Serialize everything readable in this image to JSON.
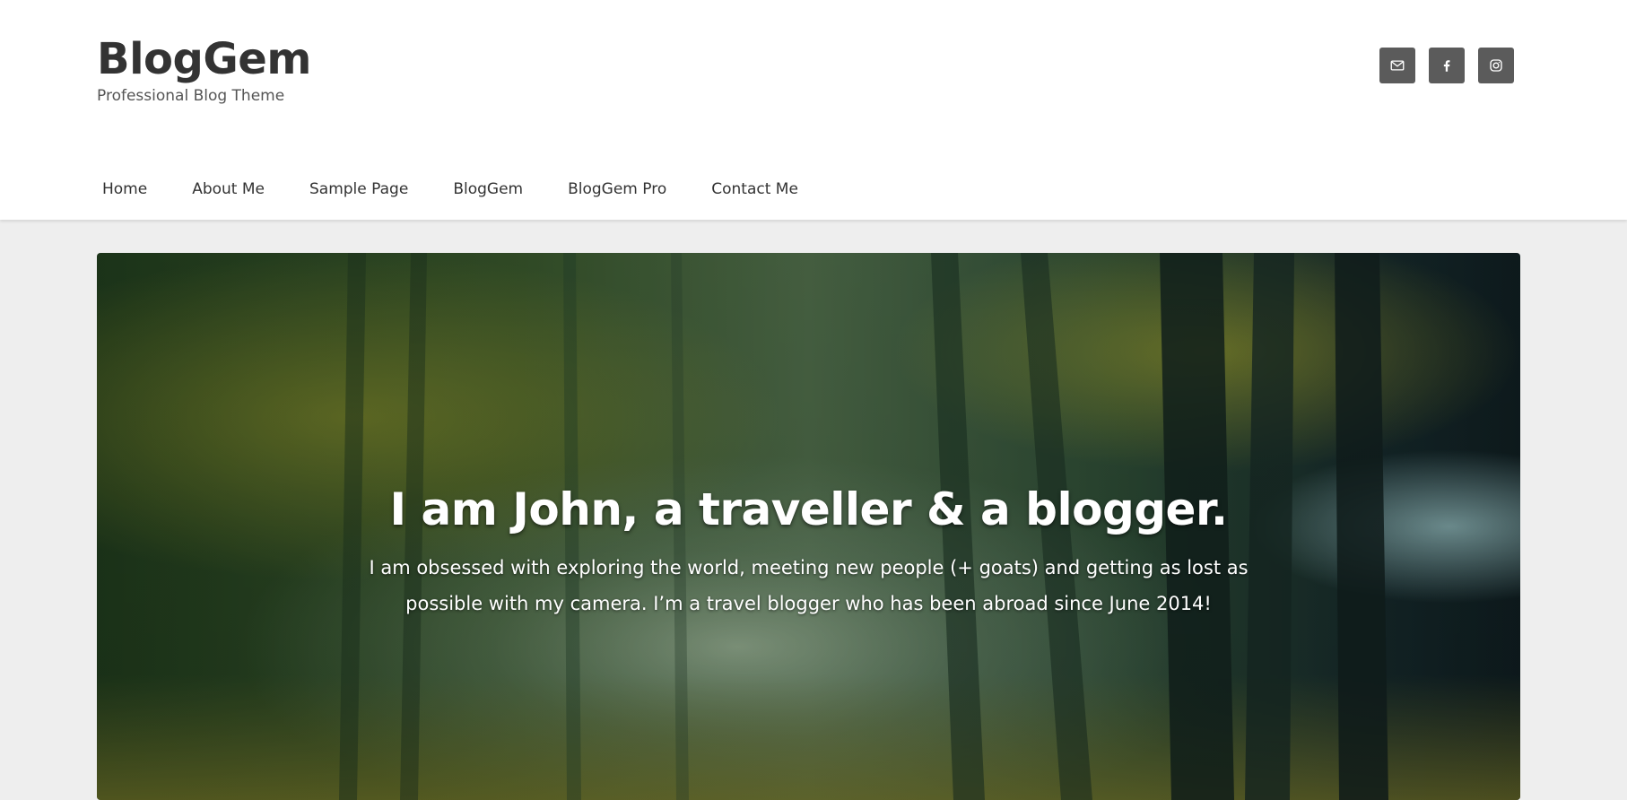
{
  "site": {
    "title": "BlogGem",
    "tagline": "Professional Blog Theme"
  },
  "social": [
    {
      "name": "email",
      "icon": "envelope-icon"
    },
    {
      "name": "facebook",
      "icon": "facebook-icon"
    },
    {
      "name": "instagram",
      "icon": "instagram-icon"
    }
  ],
  "nav": {
    "items": [
      {
        "label": "Home"
      },
      {
        "label": "About Me"
      },
      {
        "label": "Sample Page"
      },
      {
        "label": "BlogGem"
      },
      {
        "label": "BlogGem Pro"
      },
      {
        "label": "Contact Me"
      }
    ]
  },
  "hero": {
    "title": "I am John, a traveller & a blogger.",
    "description": "I am obsessed with exploring the world, meeting new people (+ goats) and getting as lost as possible with my camera. I’m a travel blogger who has been abroad since June 2014!",
    "image": "forest-path-image"
  },
  "colors": {
    "page_background": "#eeeeee",
    "header_background": "#ffffff",
    "social_button": "#5b5b5b",
    "text_dark": "#333333",
    "hero_text": "#ffffff"
  }
}
